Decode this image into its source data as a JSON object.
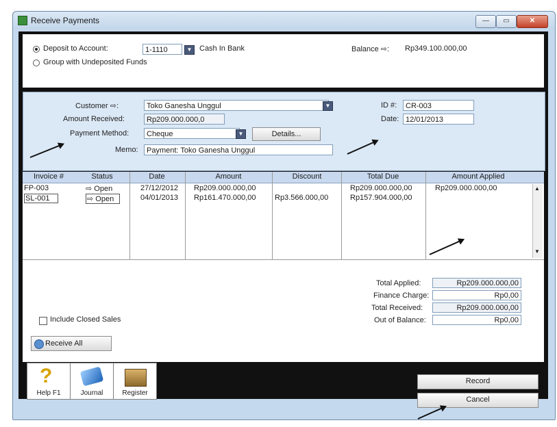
{
  "window": {
    "title": "Receive Payments",
    "min": "—",
    "max": "▭",
    "close": "✕"
  },
  "deposit": {
    "deposit_option": "Deposit to Account:",
    "account_code": "1-1110",
    "account_name": "Cash In Bank",
    "group_option": "Group with Undeposited Funds",
    "balance_label": "Balance ⇨:",
    "balance_value": "Rp349.100.000,00"
  },
  "customer": {
    "customer_label": "Customer ⇨:",
    "customer_value": "Toko Ganesha Unggul",
    "amount_label": "Amount Received:",
    "amount_value": "Rp209.000.000,0",
    "method_label": "Payment Method:",
    "method_value": "Cheque",
    "details_label": "Details...",
    "memo_label": "Memo:",
    "memo_value": "Payment: Toko Ganesha Unggul",
    "id_label": "ID #:",
    "id_value": "CR-003",
    "date_label": "Date:",
    "date_value": "12/01/2013"
  },
  "grid": {
    "headers": [
      "Invoice #",
      "Status",
      "Date",
      "Amount",
      "Discount",
      "Total Due",
      "Amount Applied"
    ],
    "rows": [
      {
        "invoice": "FP-003",
        "status": "⇨ Open",
        "date": "27/12/2012",
        "amount": "Rp209.000.000,00",
        "discount": "",
        "total_due": "Rp209.000.000,00",
        "applied": "Rp209.000.000,00"
      },
      {
        "invoice": "SL-001",
        "status": "⇨ Open",
        "date": "04/01/2013",
        "amount": "Rp161.470.000,00",
        "discount": "Rp3.566.000,00",
        "total_due": "Rp157.904.000,00",
        "applied": ""
      }
    ]
  },
  "totals": {
    "applied_label": "Total Applied:",
    "applied_value": "Rp209.000.000,00",
    "finance_label": "Finance Charge:",
    "finance_value": "Rp0,00",
    "received_label": "Total Received:",
    "received_value": "Rp209.000.000,00",
    "oob_label": "Out of Balance:",
    "oob_value": "Rp0,00"
  },
  "include_closed_label": "Include Closed Sales",
  "receive_all_label": "Receive All",
  "toolbar": {
    "help": "Help F1",
    "journal": "Journal",
    "register": "Register"
  },
  "actions": {
    "record": "Record",
    "cancel": "Cancel"
  },
  "colors": {
    "frame": "#c5d9ee",
    "panel": "#dbe8f6",
    "close": "#c4422a"
  }
}
